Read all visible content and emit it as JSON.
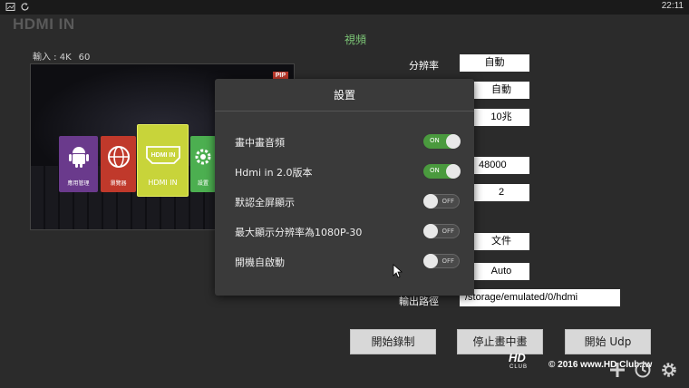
{
  "statusbar": {
    "time": "22:11"
  },
  "app": {
    "title": "HDMI IN"
  },
  "input_info": {
    "label": "輸入 : 4K",
    "rate": "60"
  },
  "section": {
    "title": "視頻"
  },
  "preview": {
    "pip_badge": "PIP",
    "tiles": [
      {
        "label": "應用管理",
        "color": "#6a3a8c"
      },
      {
        "label": "瀏覽器",
        "color": "#c0392b"
      },
      {
        "label": "HDMI IN",
        "color": "#c8d43a"
      },
      {
        "label": "設置",
        "color": "#4caf50"
      }
    ]
  },
  "settings": {
    "resolution_label": "分辨率",
    "resolution_value": "自動",
    "value_2": "自動",
    "value_3": "10兆",
    "value_4": "48000",
    "value_5": "2",
    "value_6": "文件",
    "value_7": "Auto",
    "path_label": "輸出路徑",
    "path_value": "/storage/emulated/0/hdmi"
  },
  "buttons": {
    "start_record": "開始錄制",
    "stop_pip": "停止畫中畫",
    "start_udp": "開始 Udp"
  },
  "dialog": {
    "title": "設置",
    "rows": [
      {
        "label": "畫中畫音頻",
        "state": "ON"
      },
      {
        "label": "Hdmi in 2.0版本",
        "state": "ON"
      },
      {
        "label": "默認全屏顯示",
        "state": "OFF"
      },
      {
        "label": "最大顯示分辨率為1080P-30",
        "state": "OFF"
      },
      {
        "label": "開機自啟動",
        "state": "OFF"
      }
    ]
  },
  "watermark": {
    "text": "© 2016  www.HD.Club.tw"
  },
  "colors": {
    "accent_green": "#7cc576",
    "toggle_on": "#4a9a3e"
  },
  "icons": [
    "screenshot-icon",
    "sync-icon",
    "plus-icon",
    "clock-icon",
    "gear-icon"
  ]
}
